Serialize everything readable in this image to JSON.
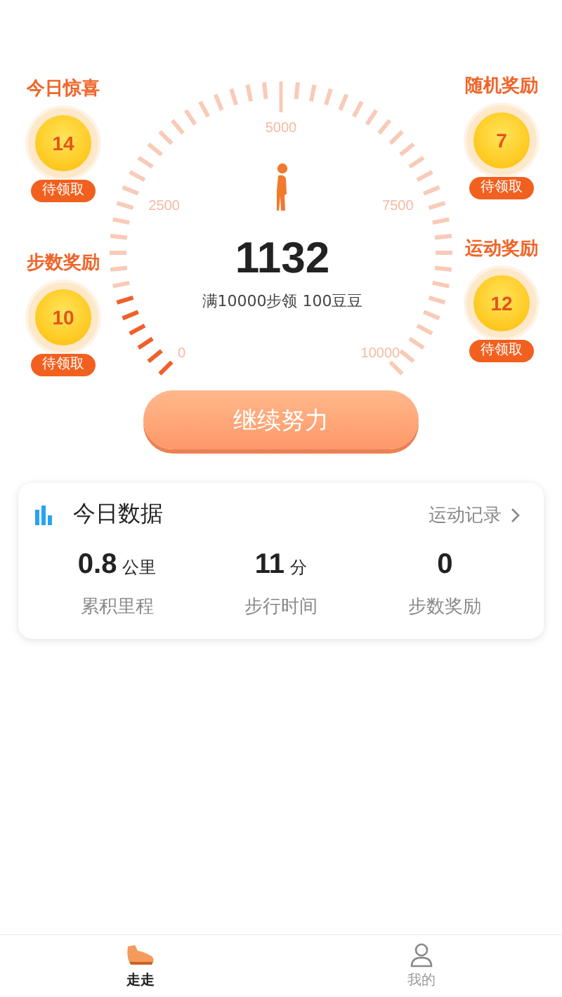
{
  "left_rewards": [
    {
      "title": "今日惊喜",
      "amount": "14",
      "status": "待领取"
    },
    {
      "title": "步数奖励",
      "amount": "10",
      "status": "待领取"
    }
  ],
  "right_rewards": [
    {
      "title": "随机奖励",
      "amount": "7",
      "status": "待领取"
    },
    {
      "title": "运动奖励",
      "amount": "12",
      "status": "待领取"
    }
  ],
  "gauge": {
    "scale_labels": [
      "0",
      "2500",
      "5000",
      "7500",
      "10000"
    ],
    "steps": "1132",
    "goal_text": "满10000步领 100豆豆"
  },
  "action_button": "继续努力",
  "today_card": {
    "title": "今日数据",
    "link": "运动记录",
    "stats": [
      {
        "value": "0.8",
        "unit": "公里",
        "label": "累积里程"
      },
      {
        "value": "11",
        "unit": "分",
        "label": "步行时间"
      },
      {
        "value": "0",
        "label": "步数奖励"
      }
    ]
  },
  "tabs": [
    {
      "label": "走走",
      "kind": "walk",
      "selected": true
    },
    {
      "label": "我的",
      "kind": "profile",
      "selected": false
    }
  ]
}
